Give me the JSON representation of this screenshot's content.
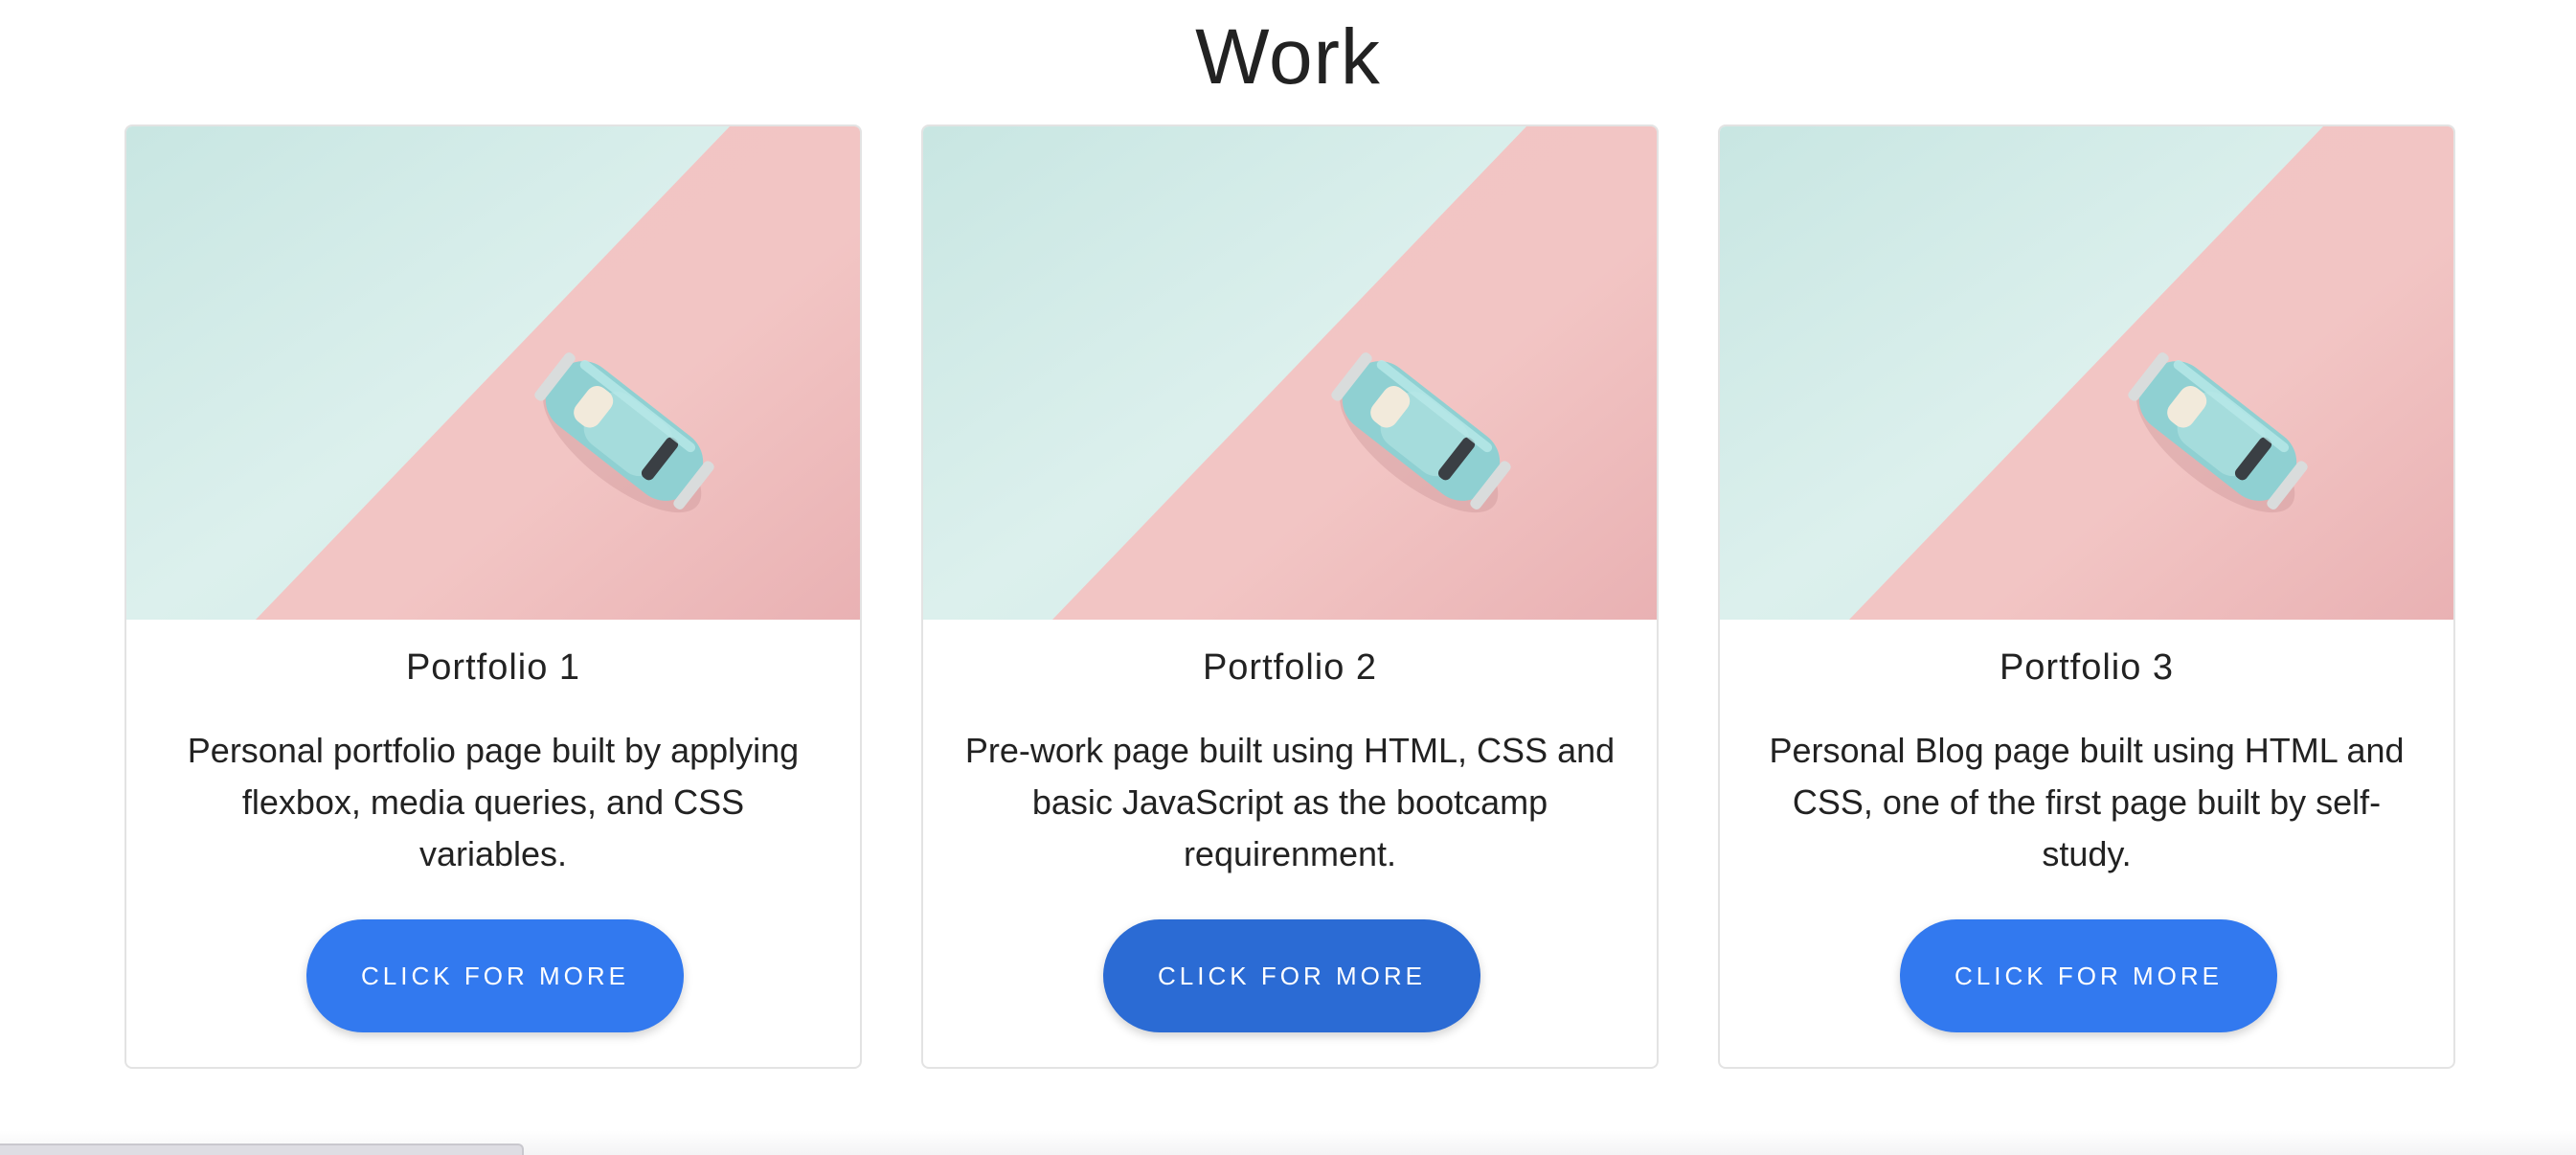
{
  "section": {
    "title": "Work"
  },
  "cards": [
    {
      "title": "Portfolio 1",
      "description": "Personal portfolio page built by applying flexbox, media queries, and CSS variables.",
      "button_label": "CLICK FOR MORE"
    },
    {
      "title": "Portfolio 2",
      "description": "Pre-work page built using HTML, CSS and basic JavaScript as the bootcamp requirenment.",
      "button_label": "CLICK FOR MORE"
    },
    {
      "title": "Portfolio 3",
      "description": "Personal Blog page built using HTML and CSS, one of the first page built by self-study.",
      "button_label": "CLICK FOR MORE"
    }
  ],
  "colors": {
    "button": "#3279ef",
    "button_hover": "#2b6bd4",
    "image_mint": "#cde9e6",
    "image_pink": "#f1c1c2",
    "card_border": "#e3e3e3"
  },
  "icons": {
    "card_image": "toy-car-image"
  }
}
